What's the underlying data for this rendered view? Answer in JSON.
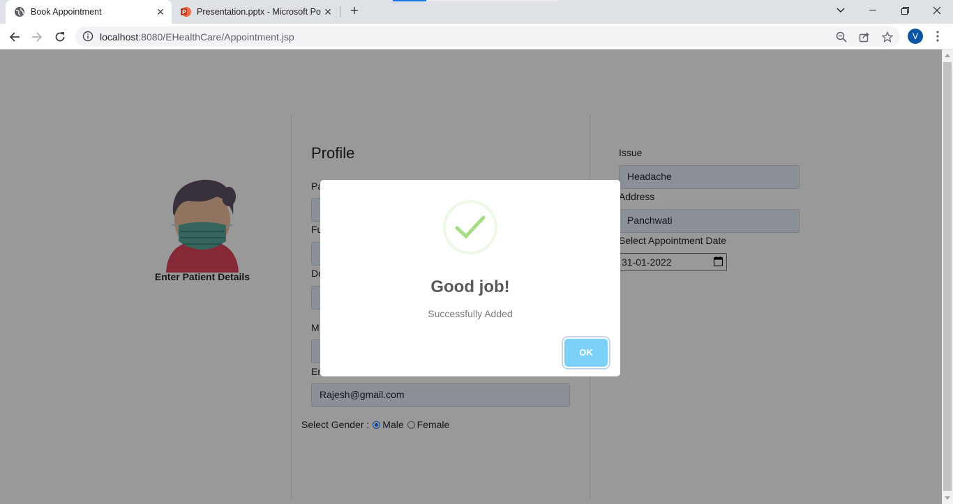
{
  "browser": {
    "tabs": [
      {
        "title": "Book Appointment",
        "icon": "globe-icon"
      },
      {
        "title": "Presentation.pptx - Microsoft PowerPoint",
        "icon": "powerpoint-icon"
      }
    ],
    "url_host": "localhost",
    "url_rest": ":8080/EHealthCare/Appointment.jsp",
    "profile_initial": "V"
  },
  "left": {
    "caption": "Enter Patient Details"
  },
  "profile": {
    "title": "Profile",
    "labels": {
      "patient": "Pa",
      "fullname": "Fu",
      "doctor": "Do",
      "mobile": "M",
      "email": "Em"
    },
    "email_value": "Rajesh@gmail.com",
    "gender_label": "Select Gender :",
    "gender_options": [
      "Male",
      "Female"
    ],
    "gender_selected": "Male"
  },
  "right": {
    "issue_label": "Issue",
    "issue_value": "Headache",
    "address_label": "Address",
    "address_value": "Panchwati",
    "date_label": "Select Appointment Date",
    "date_value": "31-01-2022"
  },
  "modal": {
    "title": "Good job!",
    "text": "Successfully Added",
    "ok_label": "OK",
    "icon": "success-check-icon",
    "accent_color": "#a5dc86",
    "button_color": "#7cd1f9"
  }
}
